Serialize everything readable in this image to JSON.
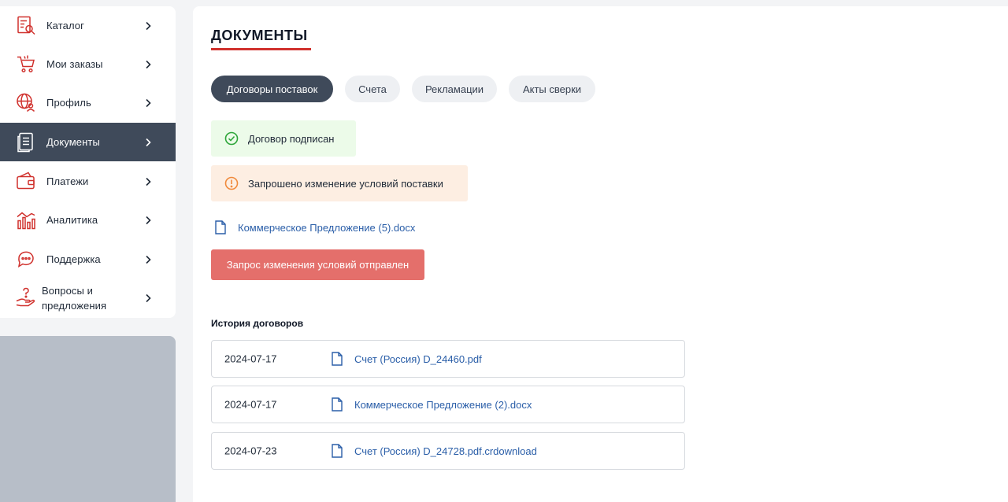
{
  "sidebar": {
    "items": [
      {
        "label": "Каталог",
        "icon": "catalog-icon"
      },
      {
        "label": "Мои заказы",
        "icon": "cart-icon"
      },
      {
        "label": "Профиль",
        "icon": "profile-globe-icon"
      },
      {
        "label": "Документы",
        "icon": "documents-icon",
        "active": true
      },
      {
        "label": "Платежи",
        "icon": "wallet-icon"
      },
      {
        "label": "Аналитика",
        "icon": "analytics-icon"
      },
      {
        "label": "Поддержка",
        "icon": "support-chat-icon"
      },
      {
        "label": "Вопросы и предложения",
        "icon": "question-hand-icon"
      }
    ]
  },
  "main": {
    "title": "ДОКУМЕНТЫ",
    "tabs": [
      {
        "label": "Договоры поставок",
        "active": true
      },
      {
        "label": "Счета"
      },
      {
        "label": "Рекламации"
      },
      {
        "label": "Акты сверки"
      }
    ],
    "alerts": {
      "success": "Договор подписан",
      "warning": "Запрошено изменение условий поставки"
    },
    "attachment": "Коммерческое Предложение (5).docx",
    "action_button": "Запрос изменения условий отправлен",
    "history": {
      "title": "История договоров",
      "rows": [
        {
          "date": "2024-07-17",
          "file": "Счет (Россия) D_24460.pdf"
        },
        {
          "date": "2024-07-17",
          "file": "Коммерческое Предложение (2).docx"
        },
        {
          "date": "2024-07-23",
          "file": "Счет (Россия) D_24728.pdf.crdownload"
        }
      ]
    }
  },
  "colors": {
    "accent_red": "#d0312d",
    "nav_active": "#3f4a5a",
    "success_bg": "#ecfbe9",
    "warning_bg": "#fdeee2",
    "link": "#2a5ea8",
    "button": "#e46f6b"
  }
}
